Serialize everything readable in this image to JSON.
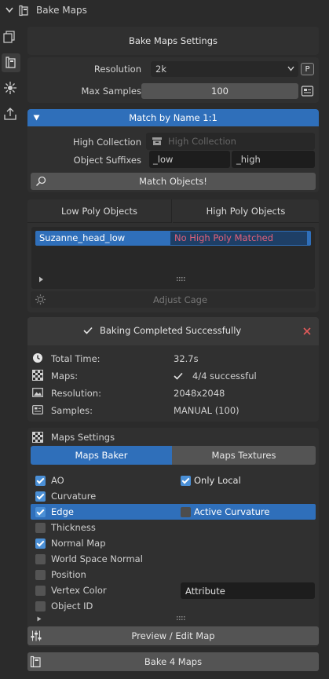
{
  "header": {
    "title": "Bake Maps"
  },
  "settings_button": "Bake Maps Settings",
  "resolution": {
    "label": "Resolution",
    "value": "2k",
    "preset_button": "P"
  },
  "max_samples": {
    "label": "Max Samples",
    "value": "100"
  },
  "match_panel": {
    "title": "Match by Name 1:1",
    "high_collection_label": "High Collection",
    "high_collection_placeholder": "High Collection",
    "suffixes_label": "Object Suffixes",
    "low_suffix": "_low",
    "high_suffix": "_high",
    "match_button": "Match Objects!"
  },
  "objects_tabs": {
    "low": "Low Poly Objects",
    "high": "High Poly Objects"
  },
  "object_list": [
    {
      "low": "Suzanne_head_low",
      "high": "No High Poly Matched"
    }
  ],
  "adjust_cage_button": "Adjust Cage",
  "result": {
    "status": "Baking Completed Successfully",
    "rows": [
      {
        "label": "Total Time:",
        "value": "32.7s"
      },
      {
        "label": "Maps:",
        "value": "4/4 successful"
      },
      {
        "label": "Resolution:",
        "value": "2048x2048"
      },
      {
        "label": "Samples:",
        "value": "MANUAL (100)"
      }
    ]
  },
  "maps_settings": {
    "title": "Maps Settings",
    "tab_baker": "Maps Baker",
    "tab_textures": "Maps Textures",
    "maps": [
      {
        "label": "AO",
        "checked": true
      },
      {
        "label": "Curvature",
        "checked": true
      },
      {
        "label": "Edge",
        "checked": true
      },
      {
        "label": "Thickness",
        "checked": false
      },
      {
        "label": "Normal Map",
        "checked": true
      },
      {
        "label": "World Space Normal",
        "checked": false
      },
      {
        "label": "Position",
        "checked": false
      },
      {
        "label": "Vertex Color",
        "checked": false
      },
      {
        "label": "Object ID",
        "checked": false
      }
    ],
    "only_local": {
      "label": "Only Local",
      "checked": true
    },
    "active_curvature": {
      "label": "Active Curvature",
      "checked": false
    },
    "vertex_color_value": "Attribute"
  },
  "preview_button": "Preview / Edit Map",
  "bake_button": "Bake 4 Maps",
  "colors": {
    "accent": "#4a8fd6",
    "row_selected": "#2f6fba",
    "error_text": "#e0607a",
    "close_x": "#e05a5a"
  }
}
